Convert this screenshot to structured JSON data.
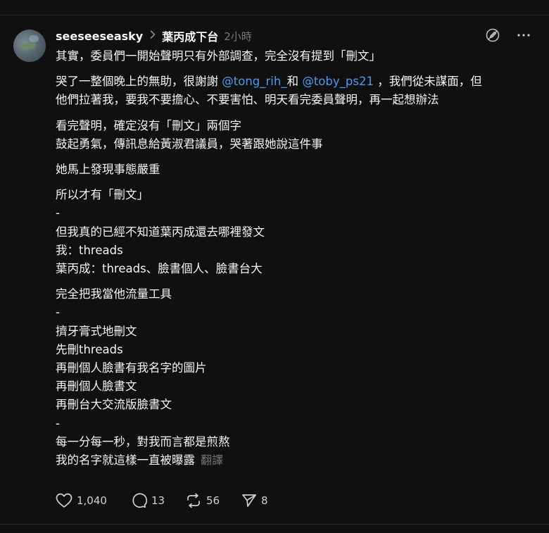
{
  "post": {
    "username": "seeseeseasky",
    "community": "葉丙成下台",
    "time": "2小時",
    "paragraphs": [
      {
        "lines": [
          [
            "其實，委員們一開始聲明只有外部調查，完全沒有提到「刪文」"
          ]
        ]
      },
      {
        "lines": [
          [
            "哭了一整個晚上的無助，很謝謝 ",
            {
              "mention": "@tong_rih_"
            },
            "和 ",
            {
              "mention": "@toby_ps21"
            },
            " ，我們從未謀面，但"
          ],
          [
            "他們拉著我，要我不要擔心、不要害怕、明天看完委員聲明，再一起想辦法"
          ]
        ]
      },
      {
        "lines": [
          [
            "看完聲明，確定沒有「刪文」兩個字"
          ],
          [
            "鼓起勇氣，傳訊息給黃淑君議員，哭著跟她說這件事"
          ]
        ]
      },
      {
        "lines": [
          [
            "她馬上發現事態嚴重"
          ]
        ]
      },
      {
        "lines": [
          [
            "所以才有「刪文」"
          ],
          [
            "-"
          ],
          [
            "但我真的已經不知道葉丙成還去哪裡發文"
          ],
          [
            "我：threads"
          ],
          [
            "葉丙成：threads、臉書個人、臉書台大"
          ]
        ]
      },
      {
        "lines": [
          [
            "完全把我當他流量工具"
          ],
          [
            "-"
          ],
          [
            "擠牙膏式地刪文"
          ],
          [
            "先刪threads"
          ],
          [
            "再刪個人臉書有我名字的圖片"
          ],
          [
            "再刪個人臉書文"
          ],
          [
            "再刪台大交流版臉書文"
          ],
          [
            "-"
          ],
          [
            "每一分每一秒，對我而言都是煎熬"
          ],
          [
            "我的名字就這樣一直被曝露"
          ]
        ]
      }
    ],
    "translate_label": "翻譯",
    "stats": {
      "likes": "1,040",
      "replies": "13",
      "reposts": "56",
      "shares": "8"
    }
  },
  "icons": {
    "header_chevron": "chevron-right-icon",
    "pen": "no-edit-icon",
    "more": "more-horizontal-icon",
    "like": "heart-icon",
    "reply": "comment-icon",
    "repost": "repost-icon",
    "share": "send-icon"
  },
  "colors": {
    "background": "#101010",
    "text": "#f3f5f7",
    "muted": "#777777",
    "mention": "#4c9bf0",
    "divider": "#2a2a2a"
  }
}
